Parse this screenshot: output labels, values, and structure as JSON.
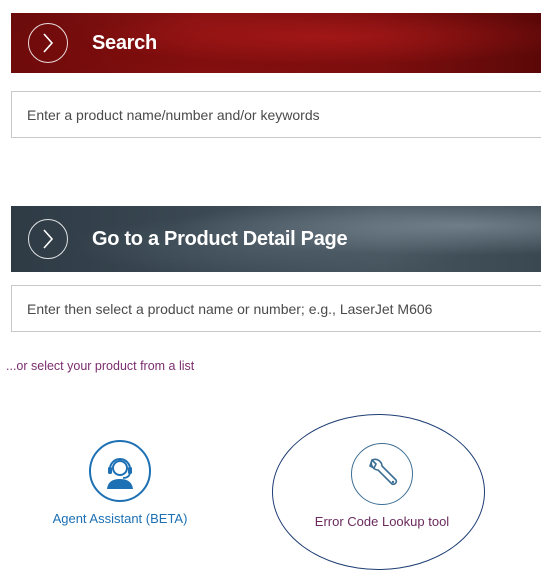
{
  "search": {
    "title": "Search",
    "placeholder": "Enter a product name/number and/or keywords"
  },
  "product_detail": {
    "title": "Go to a Product Detail Page",
    "placeholder": "Enter then select a product name or number; e.g., LaserJet M606"
  },
  "list_link": "...or select your product from a list",
  "tools": {
    "agent_assistant": {
      "label": "Agent Assistant (BETA)",
      "icon": "headset-agent-icon"
    },
    "error_code": {
      "label": "Error Code Lookup tool",
      "icon": "wrench-icon"
    }
  },
  "colors": {
    "search_banner": "#7c0e0e",
    "product_banner": "#3c4a55",
    "link": "#7b2d6e",
    "agent_blue": "#1c70b3",
    "error_label": "#6b2a5e",
    "highlight": "#1e3e74"
  }
}
